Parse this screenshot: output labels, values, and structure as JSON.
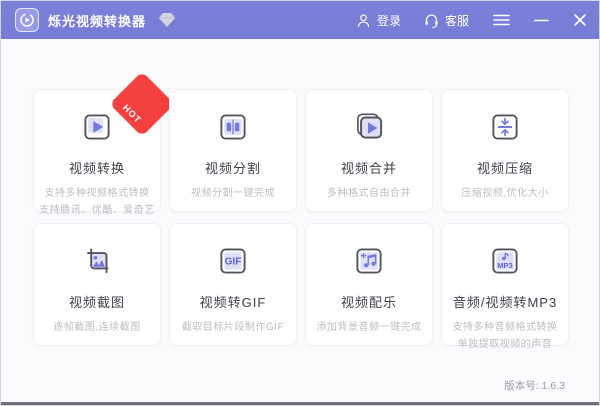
{
  "titlebar": {
    "app_title": "烁光视频转换器",
    "login_label": "登录",
    "service_label": "客服"
  },
  "cards": [
    {
      "title": "视频转换",
      "desc1": "支持多种视频格式转换",
      "desc2": "支持腾讯、优酷、爱奇艺",
      "badge": "HOT"
    },
    {
      "title": "视频分割",
      "desc1": "视频分割一键完成",
      "desc2": ""
    },
    {
      "title": "视频合并",
      "desc1": "多种格式自由合并",
      "desc2": ""
    },
    {
      "title": "视频压缩",
      "desc1": "压缩视频,优化大小",
      "desc2": ""
    },
    {
      "title": "视频截图",
      "desc1": "逐帧截图,连续截图",
      "desc2": ""
    },
    {
      "title": "视频转GIF",
      "desc1": "截取目标片段制作GIF",
      "desc2": ""
    },
    {
      "title": "视频配乐",
      "desc1": "添加背景音频一键完成",
      "desc2": ""
    },
    {
      "title": "音频/视频转MP3",
      "desc1": "支持多种音频格式转换",
      "desc2": "单独提取视频的声音"
    }
  ],
  "icon_labels": {
    "gif": "GIF",
    "mp3": "MP3"
  },
  "footer": {
    "version_label": "版本号: 1.6.3"
  },
  "colors": {
    "titlebar_bg": "#787CD6",
    "accent": "#747ADD",
    "lavender": "#DFE0F6",
    "icon_outline": "#54545E",
    "hot_red": "#F4413F",
    "card_border": "#F0F0F4"
  }
}
